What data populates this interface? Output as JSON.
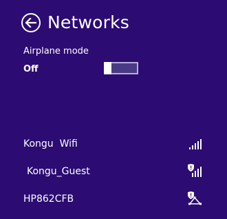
{
  "header": {
    "title": "Networks",
    "back_icon": "arrow-left-circle-icon"
  },
  "airplane": {
    "label": "Airplane mode",
    "state_text": "Off",
    "enabled": false
  },
  "networks": [
    {
      "name": "Kongu  Wifi",
      "icon": "wifi-signal-full-icon",
      "signal_bars": 5,
      "secured": false
    },
    {
      "name": "Kongu_Guest",
      "icon": "wifi-signal-shield-icon",
      "signal_bars": 5,
      "secured": true
    },
    {
      "name": "HP862CFB",
      "icon": "network-shield-icon",
      "secured": true
    }
  ]
}
